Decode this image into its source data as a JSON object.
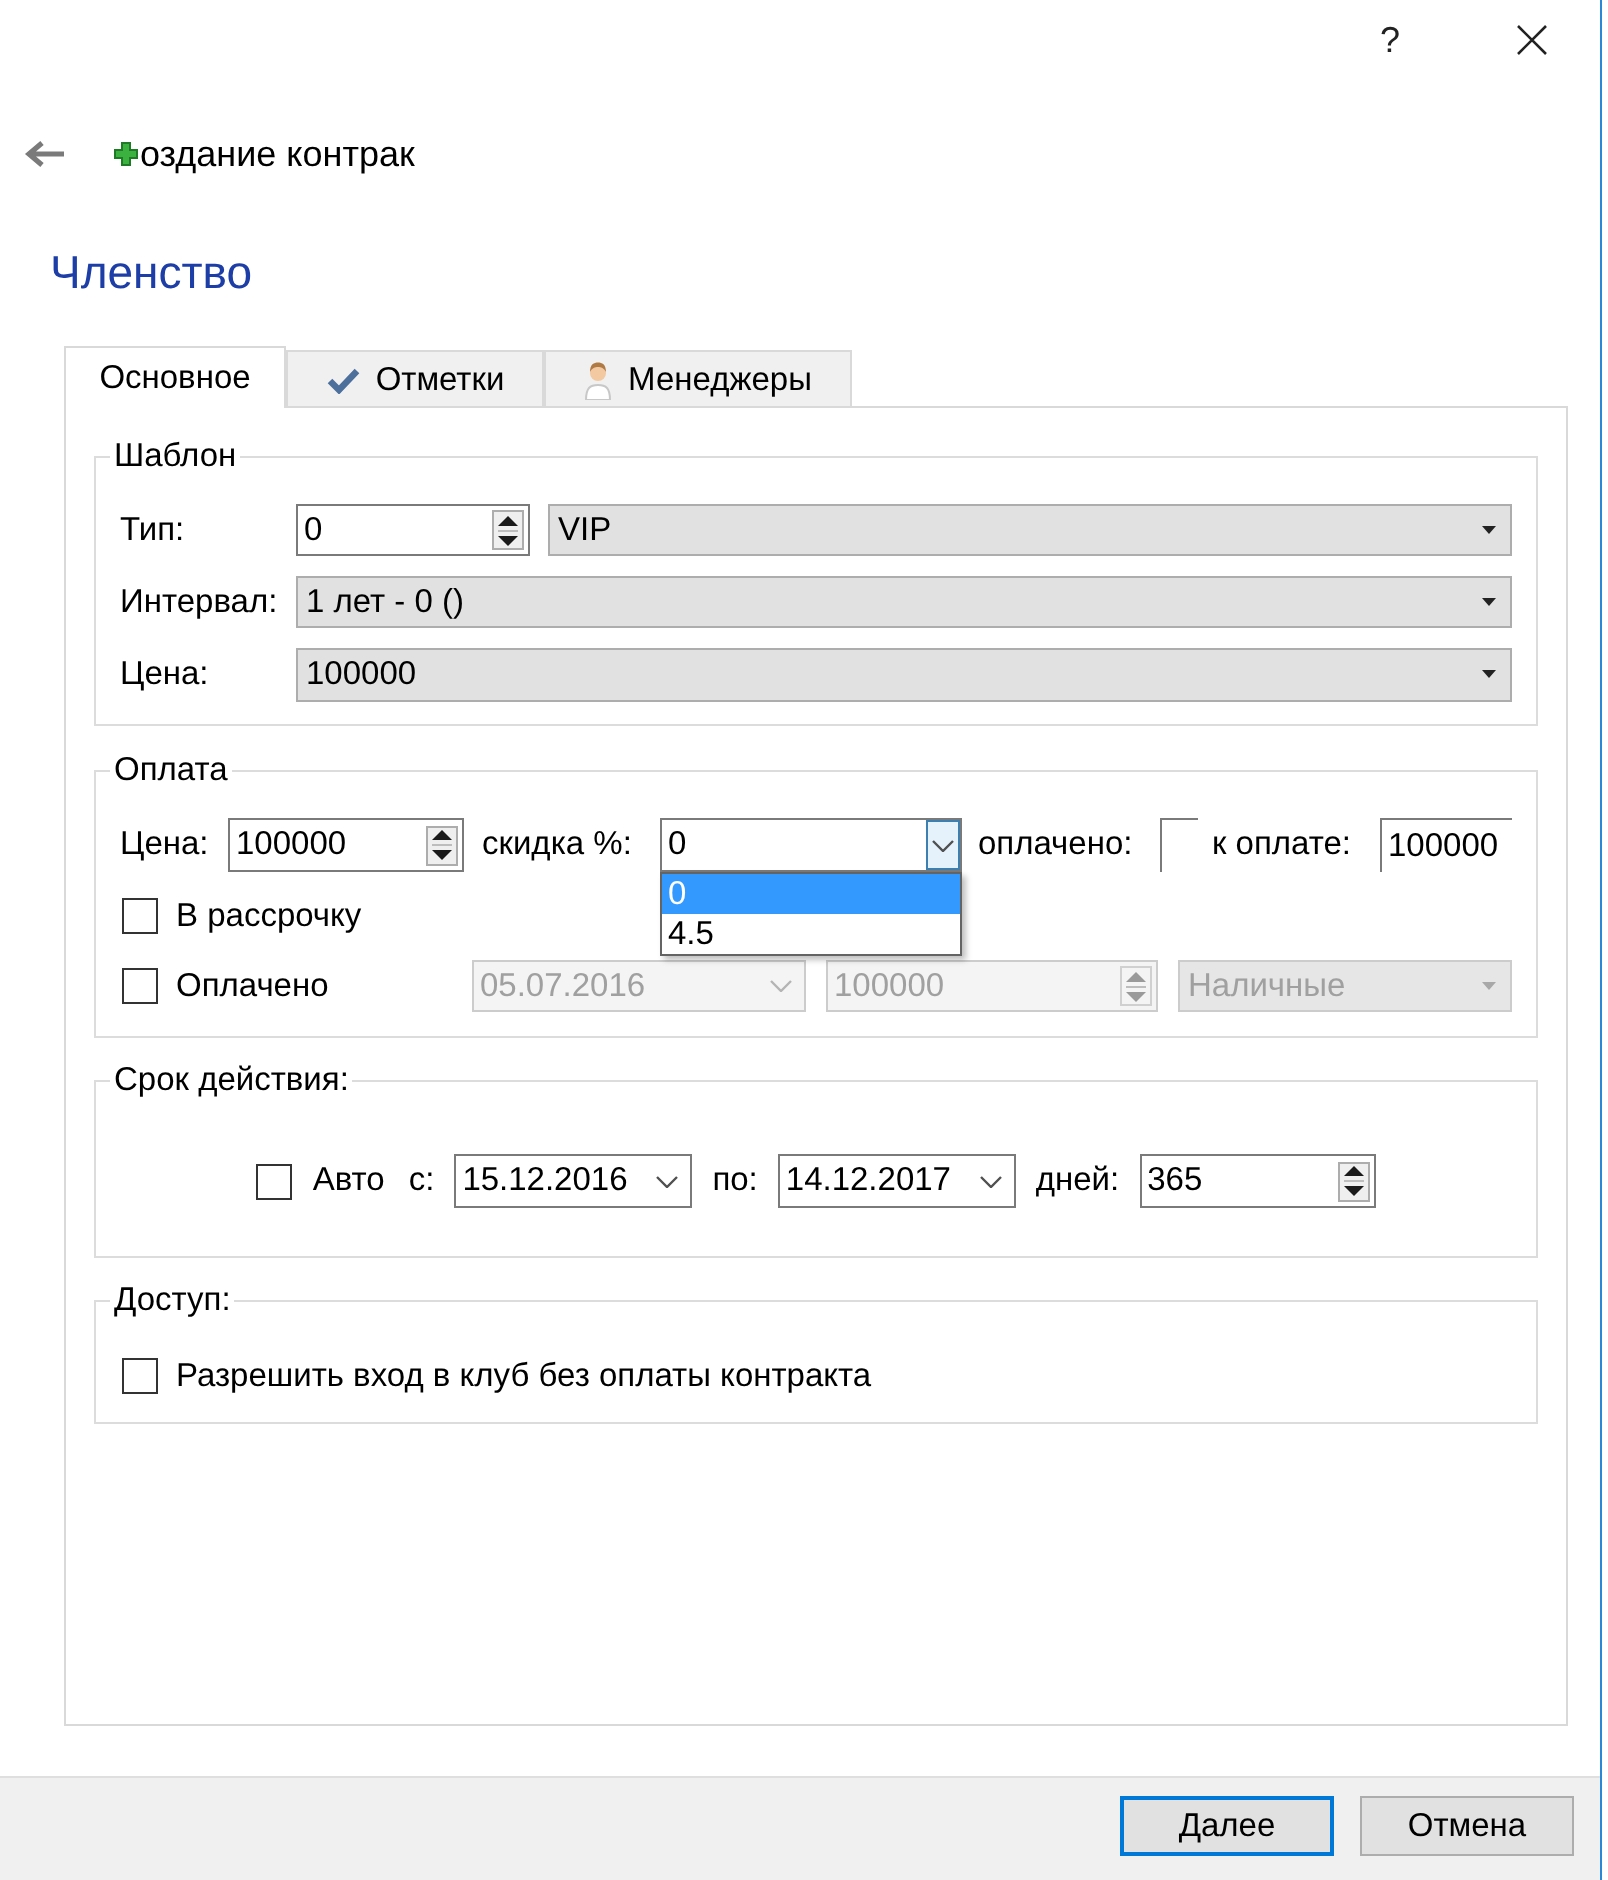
{
  "window": {
    "help": "?"
  },
  "header": {
    "title": "оздание контрак"
  },
  "page_title": "Членство",
  "tabs": [
    {
      "label": "Основное",
      "selected": true,
      "kind": "text"
    },
    {
      "label": "Отметки",
      "selected": false,
      "kind": "check"
    },
    {
      "label": "Менеджеры",
      "selected": false,
      "kind": "person"
    }
  ],
  "template": {
    "title": "Шаблон",
    "type": {
      "label": "Тип:",
      "number": "0",
      "value": "VIP"
    },
    "interval": {
      "label": "Интервал:",
      "value": "1 лет - 0 ()"
    },
    "price": {
      "label": "Цена:",
      "value": "100000"
    }
  },
  "payment": {
    "title": "Оплата",
    "price": {
      "label": "Цена:",
      "value": "100000"
    },
    "discount": {
      "label": "скидка %:",
      "value": "0",
      "expanded": true,
      "options": [
        {
          "label": "0",
          "selected": true
        },
        {
          "label": "4.5",
          "selected": false
        }
      ]
    },
    "paid": {
      "label": "оплачено:"
    },
    "due": {
      "label": "к оплате:",
      "value": "100000"
    },
    "installments": {
      "label": "В рассрочку",
      "checked": false
    },
    "paid_check": {
      "label": "Оплачено",
      "checked": false
    },
    "paid_date": {
      "value": "05.07.2016",
      "disabled": true
    },
    "paid_amount": {
      "value": "100000",
      "disabled": true
    },
    "paid_method": {
      "value": "Наличные",
      "disabled": true
    }
  },
  "validity": {
    "title": "Срок действия:",
    "auto": {
      "label": "Авто",
      "checked": false
    },
    "from": {
      "label": "с:",
      "value": "15.12.2016"
    },
    "to": {
      "label": "по:",
      "value": "14.12.2017"
    },
    "days": {
      "label": "дней:",
      "value": "365"
    }
  },
  "access": {
    "title": "Доступ:",
    "allow": {
      "label": "Разрешить вход в клуб без оплаты контракта",
      "checked": false
    }
  },
  "buttons": [
    {
      "label": "Далее",
      "default": true
    },
    {
      "label": "Отмена",
      "default": false
    }
  ]
}
